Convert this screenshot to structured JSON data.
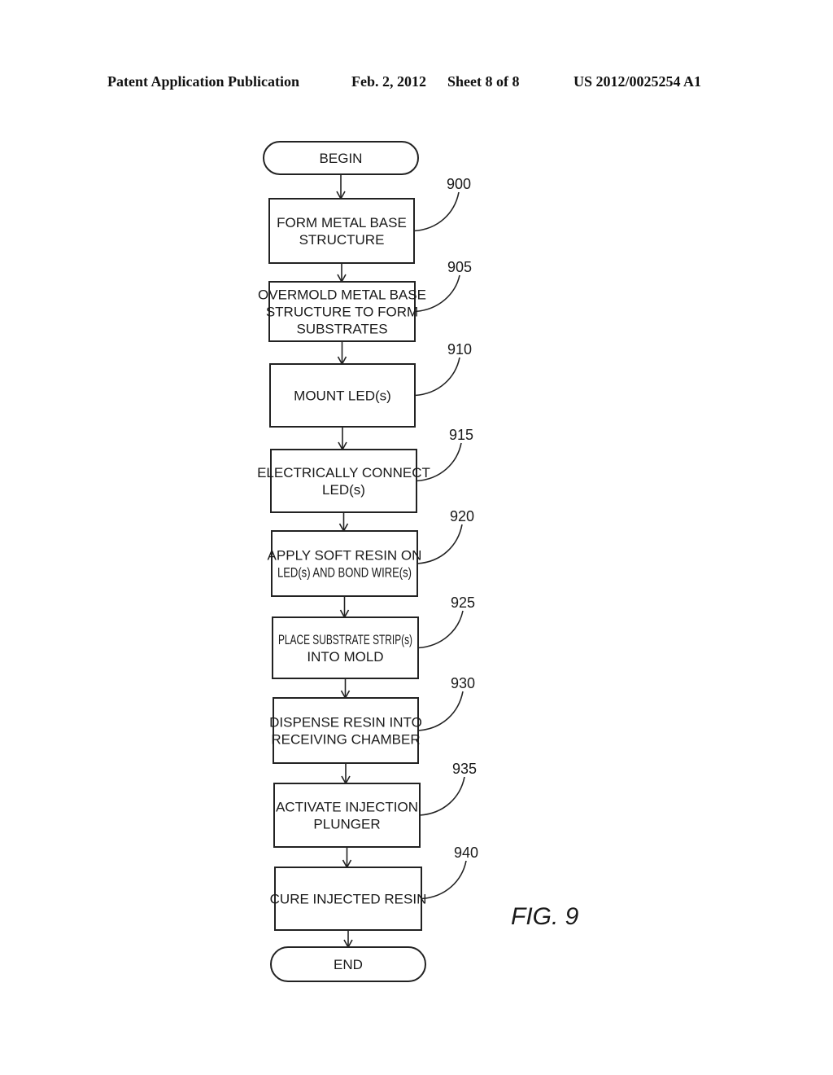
{
  "header": {
    "publication": "Patent Application Publication",
    "date": "Feb. 2, 2012",
    "sheet": "Sheet 8 of 8",
    "number": "US 2012/0025254 A1"
  },
  "figure_label": "FIG. 9",
  "terminals": {
    "begin": "BEGIN",
    "end": "END"
  },
  "steps": [
    {
      "ref": "900",
      "lines": [
        "FORM METAL BASE",
        "STRUCTURE"
      ]
    },
    {
      "ref": "905",
      "lines": [
        "OVERMOLD METAL BASE",
        "STRUCTURE TO FORM",
        "SUBSTRATES"
      ]
    },
    {
      "ref": "910",
      "lines": [
        "MOUNT LED(s)"
      ]
    },
    {
      "ref": "915",
      "lines": [
        "ELECTRICALLY CONNECT",
        "LED(s)"
      ]
    },
    {
      "ref": "920",
      "lines": [
        "APPLY SOFT RESIN ON",
        "LED(s) AND BOND WIRE(s)"
      ]
    },
    {
      "ref": "925",
      "lines": [
        "PLACE SUBSTRATE STRIP(s)",
        "INTO MOLD"
      ]
    },
    {
      "ref": "930",
      "lines": [
        "DISPENSE RESIN INTO",
        "RECEIVING CHAMBER"
      ]
    },
    {
      "ref": "935",
      "lines": [
        "ACTIVATE INJECTION",
        "PLUNGER"
      ]
    },
    {
      "ref": "940",
      "lines": [
        "CURE INJECTED RESIN"
      ]
    }
  ]
}
